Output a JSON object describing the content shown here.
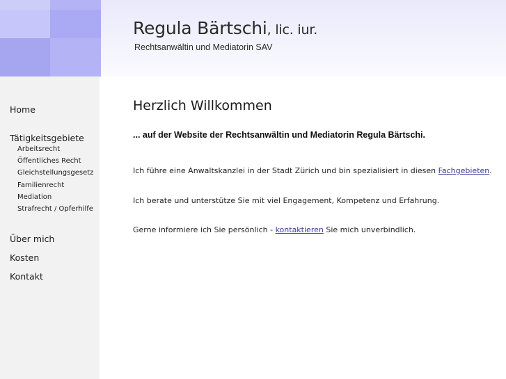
{
  "header": {
    "name": "Regula Bärtschi",
    "title_suffix": ", lic. iur.",
    "subtitle": "Rechtsanwältin und Mediatorin SAV"
  },
  "nav": {
    "home": "Home",
    "taetigkeitsgebiete": "Tätigkeitsgebiete",
    "sub": [
      "Arbeitsrecht",
      "Öffentliches Recht",
      "Gleichstellungsgesetz",
      "Familienrecht",
      "Mediation",
      "Strafrecht / Opferhilfe"
    ],
    "ueber_mich": "Über mich",
    "kosten": "Kosten",
    "kontakt": "Kontakt"
  },
  "main": {
    "heading": "Herzlich Willkommen",
    "lead": "... auf der Website der Rechtsanwältin und Mediatorin Regula Bärtschi.",
    "p1_before": "Ich führe eine Anwaltskanzlei in der Stadt Zürich und bin spezialisiert in diesen ",
    "p1_link": "Fachgebieten",
    "p1_after": ".",
    "p2": "Ich berate und unterstütze Sie mit viel Engagement, Kompetenz und Erfahrung.",
    "p3_before": "Gerne informiere ich Sie persönlich - ",
    "p3_link": "kontaktieren",
    "p3_after": " Sie mich unverbindlich."
  },
  "colors": {
    "logo_primary": "#b8b8f6",
    "header_band": "#f0f0fc",
    "sidebar_bg": "#f2f2f2",
    "link": "#3a3a9a"
  }
}
